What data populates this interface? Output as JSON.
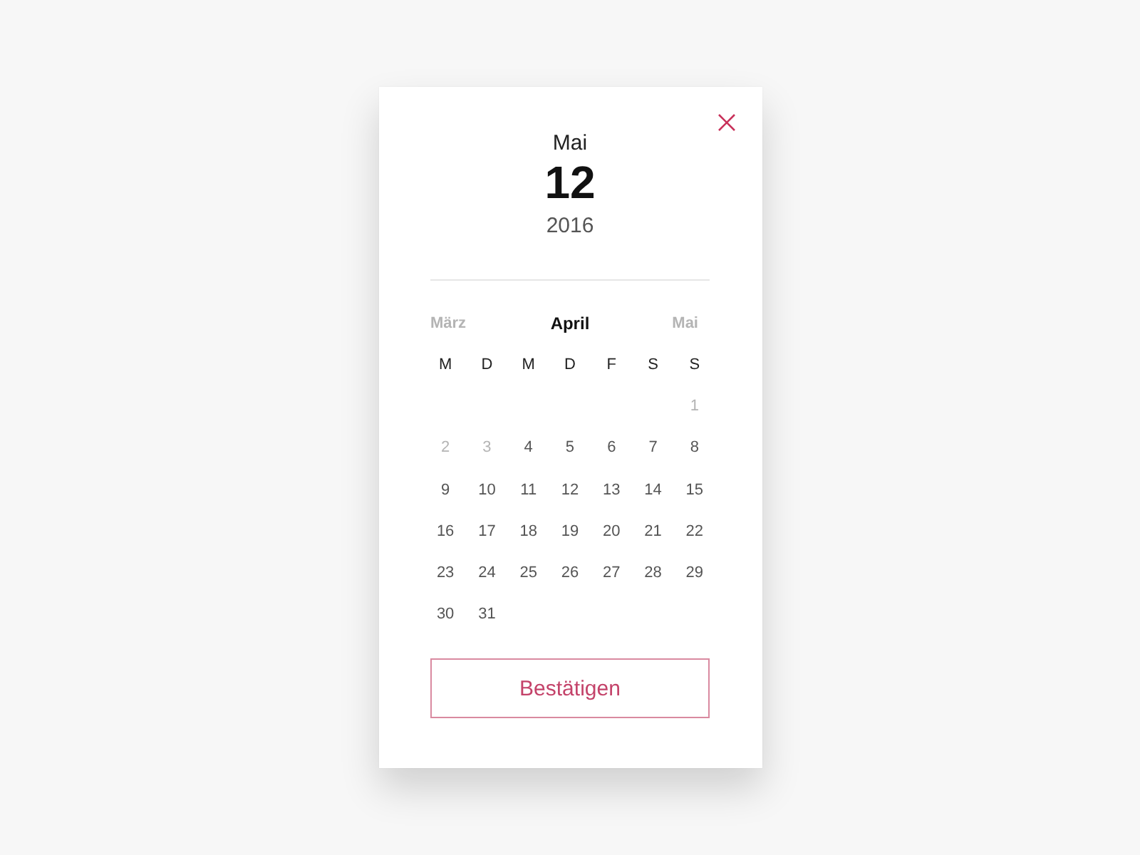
{
  "dialog": {
    "selected_date": {
      "month": "Mai",
      "day": "12",
      "year": "2016"
    },
    "month_nav": [
      {
        "label": "März",
        "selected": false
      },
      {
        "label": "April",
        "selected": true
      },
      {
        "label": "Mai",
        "selected": false
      }
    ],
    "weekdays": [
      "M",
      "D",
      "M",
      "D",
      "F",
      "S",
      "S"
    ],
    "weeks": [
      {
        "days": [
          {
            "label": "1",
            "disabled": true
          }
        ]
      },
      {
        "days": [
          {
            "label": "2",
            "disabled": true
          },
          {
            "label": "3",
            "disabled": true
          },
          {
            "label": "4",
            "disabled": false
          },
          {
            "label": "5",
            "disabled": false
          },
          {
            "label": "6",
            "disabled": false
          },
          {
            "label": "7",
            "disabled": false
          },
          {
            "label": "8",
            "disabled": false
          }
        ]
      },
      {
        "days": [
          {
            "label": "9",
            "disabled": false
          },
          {
            "label": "10",
            "disabled": false
          },
          {
            "label": "11",
            "disabled": false
          },
          {
            "label": "12",
            "disabled": false
          },
          {
            "label": "13",
            "disabled": false
          },
          {
            "label": "14",
            "disabled": false
          },
          {
            "label": "15",
            "disabled": false
          }
        ]
      },
      {
        "days": [
          {
            "label": "16",
            "disabled": false
          },
          {
            "label": "17",
            "disabled": false
          },
          {
            "label": "18",
            "disabled": false
          },
          {
            "label": "19",
            "disabled": false
          },
          {
            "label": "20",
            "disabled": false
          },
          {
            "label": "21",
            "disabled": false
          },
          {
            "label": "22",
            "disabled": false
          }
        ]
      },
      {
        "days": [
          {
            "label": "23",
            "disabled": false
          },
          {
            "label": "24",
            "disabled": false
          },
          {
            "label": "25",
            "disabled": false
          },
          {
            "label": "26",
            "disabled": false
          },
          {
            "label": "27",
            "disabled": false
          },
          {
            "label": "28",
            "disabled": false
          },
          {
            "label": "29",
            "disabled": false
          }
        ]
      },
      {
        "days": [
          {
            "label": "30",
            "disabled": false
          },
          {
            "label": "31",
            "disabled": false
          }
        ]
      }
    ],
    "confirm_button": "Bestätigen"
  }
}
